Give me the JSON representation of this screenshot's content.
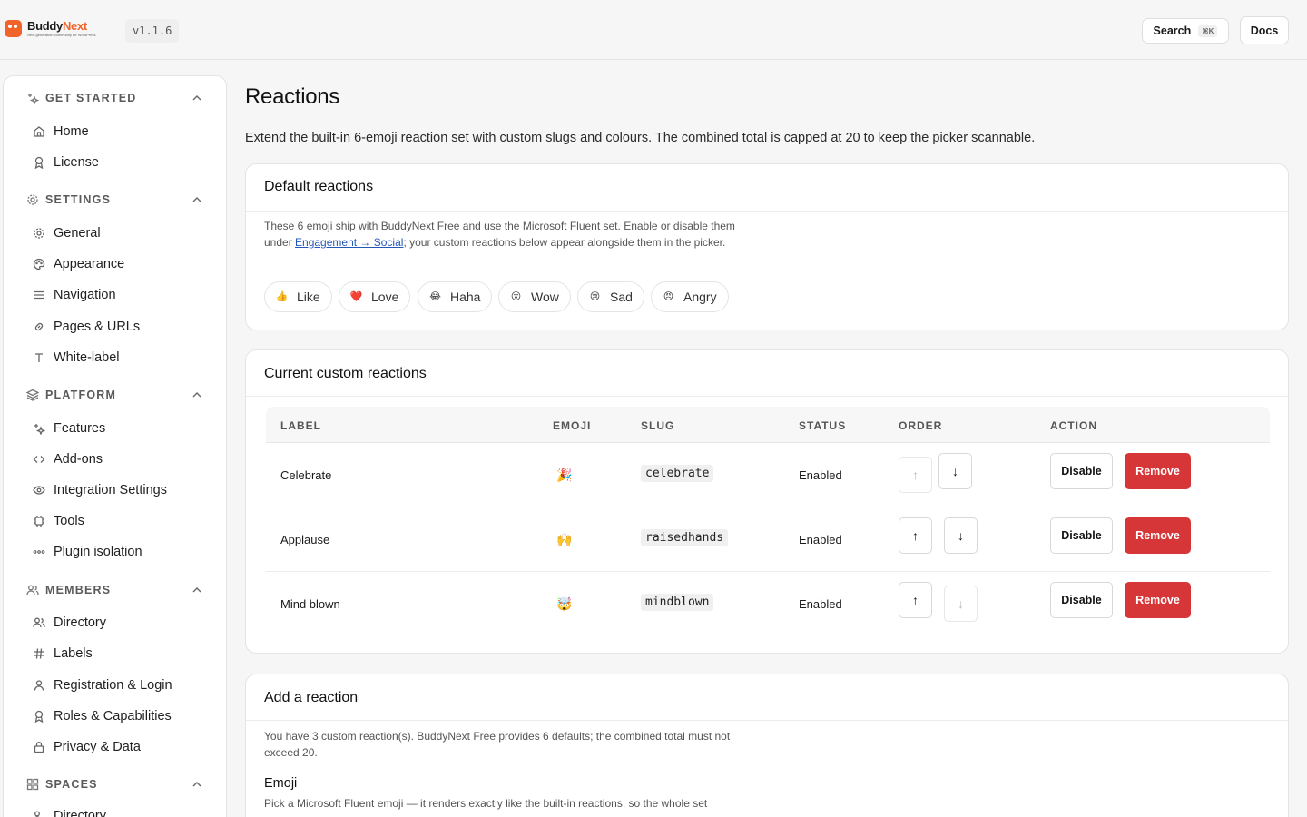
{
  "app": {
    "brand_part1": "Buddy",
    "brand_part2": "Next",
    "brand_tagline": "Next-generation community for WordPress",
    "version": "v1.1.6",
    "search_label": "Search",
    "search_shortcut": "⌘K",
    "docs_label": "Docs",
    "accent_color": "#f0642a"
  },
  "sidebar": {
    "sections": [
      {
        "label": "GET STARTED",
        "icon": "sparkles-icon",
        "items": [
          {
            "label": "Home",
            "icon": "home-icon"
          },
          {
            "label": "License",
            "icon": "award-icon"
          }
        ]
      },
      {
        "label": "SETTINGS",
        "icon": "gear-icon",
        "items": [
          {
            "label": "General",
            "icon": "gear-icon"
          },
          {
            "label": "Appearance",
            "icon": "palette-icon"
          },
          {
            "label": "Navigation",
            "icon": "list-icon"
          },
          {
            "label": "Pages & URLs",
            "icon": "link-icon"
          },
          {
            "label": "White-label",
            "icon": "type-icon"
          }
        ]
      },
      {
        "label": "PLATFORM",
        "icon": "layers-icon",
        "items": [
          {
            "label": "Features",
            "icon": "sparkles-icon"
          },
          {
            "label": "Add-ons",
            "icon": "code-icon"
          },
          {
            "label": "Integration Settings",
            "icon": "eye-icon"
          },
          {
            "label": "Tools",
            "icon": "chip-icon"
          },
          {
            "label": "Plugin isolation",
            "icon": "dots-icon"
          }
        ]
      },
      {
        "label": "MEMBERS",
        "icon": "users-icon",
        "items": [
          {
            "label": "Directory",
            "icon": "users-icon"
          },
          {
            "label": "Labels",
            "icon": "hash-icon"
          },
          {
            "label": "Registration & Login",
            "icon": "user-icon"
          },
          {
            "label": "Roles & Capabilities",
            "icon": "award-icon"
          },
          {
            "label": "Privacy & Data",
            "icon": "lock-icon"
          }
        ]
      },
      {
        "label": "SPACES",
        "icon": "grid-icon",
        "items": [
          {
            "label": "Directory",
            "icon": "users-icon"
          }
        ]
      }
    ]
  },
  "main": {
    "title": "Reactions",
    "description": "Extend the built-in 6-emoji reaction set with custom slugs and colours. The combined total is capped at 20 to keep the picker scannable.",
    "default_card": {
      "title": "Default reactions",
      "text_before": "These 6 emoji ship with BuddyNext Free and use the Microsoft Fluent set. Enable or disable them under ",
      "link_text": "Engagement → Social",
      "text_after": "; your custom reactions below appear alongside them in the picker.",
      "reactions": [
        {
          "label": "Like",
          "emoji": "👍",
          "color": "#f5b83d"
        },
        {
          "label": "Love",
          "emoji": "❤️",
          "color": "#e0245e"
        },
        {
          "label": "Haha",
          "emoji": "😂",
          "color": "#f5b83d"
        },
        {
          "label": "Wow",
          "emoji": "😮",
          "color": "#f5b83d"
        },
        {
          "label": "Sad",
          "emoji": "😢",
          "color": "#f5b83d"
        },
        {
          "label": "Angry",
          "emoji": "😠",
          "color": "#f5b83d"
        }
      ]
    },
    "custom_card": {
      "title": "Current custom reactions",
      "columns": [
        "LABEL",
        "EMOJI",
        "SLUG",
        "STATUS",
        "ORDER",
        "ACTION"
      ],
      "disable_label": "Disable",
      "remove_label": "Remove",
      "remove_color": "#d63638",
      "rows": [
        {
          "label": "Celebrate",
          "emoji": "🎉",
          "slug": "celebrate",
          "status": "Enabled"
        },
        {
          "label": "Applause",
          "emoji": "🙌",
          "slug": "raisedhands",
          "status": "Enabled"
        },
        {
          "label": "Mind blown",
          "emoji": "🤯",
          "slug": "mindblown",
          "status": "Enabled"
        }
      ]
    },
    "add_card": {
      "title": "Add a reaction",
      "text": "You have 3 custom reaction(s). BuddyNext Free provides 6 defaults; the combined total must not exceed 20.",
      "emoji_label": "Emoji",
      "emoji_help": "Pick a Microsoft Fluent emoji — it renders exactly like the built-in reactions, so the whole set"
    }
  }
}
